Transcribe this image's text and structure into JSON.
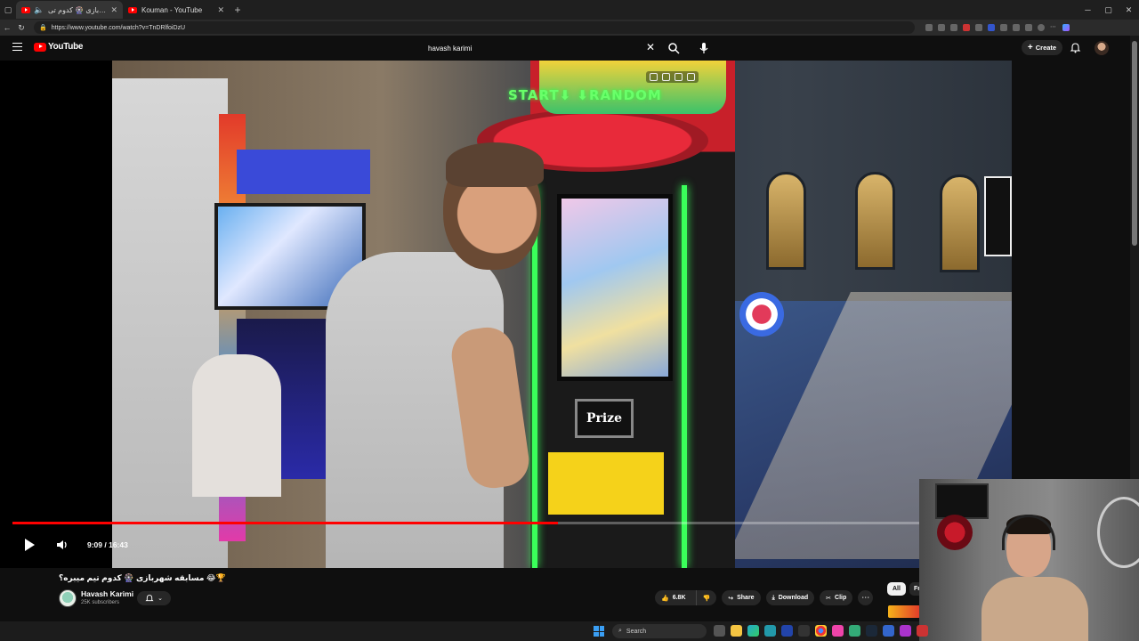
{
  "browser": {
    "tabs": [
      {
        "title": "مسابقه شهربازی 🎡 کدوم تی...",
        "active": true
      },
      {
        "title": "Kouman - YouTube",
        "active": false
      }
    ],
    "url": "https://www.youtube.com/watch?v=TnDRlfoiDzU"
  },
  "youtube": {
    "logo_text": "YouTube",
    "search_query": "havash karimi",
    "create_label": "Create"
  },
  "player": {
    "time_label": "9:09 / 16:43",
    "progress_fraction": 0.546,
    "machine_sign": "START⬇ ⬇RANDOM",
    "prize_text": "Prize"
  },
  "video": {
    "title": "🏆😂 مسابقه شهربازی 🎡 کدوم تیم میبره؟",
    "channel_name": "Havash Karimi",
    "subscribers": "25K subscribers",
    "likes": "6.8K",
    "share_label": "Share",
    "download_label": "Download",
    "clip_label": "Clip"
  },
  "chips": {
    "all_label": "All",
    "next_label": "Fr"
  },
  "taskbar": {
    "search_label": "Search"
  },
  "colors": {
    "brand_red": "#ff0000",
    "background": "#0f0f0f",
    "pill": "#272727"
  }
}
